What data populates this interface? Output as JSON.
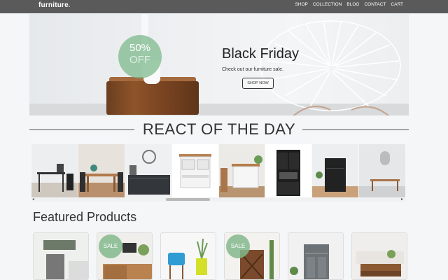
{
  "nav": {
    "logo": "furniture",
    "logo_dot": ".",
    "links": [
      "SHOP",
      "COLLECTION",
      "BLOG",
      "CONTACT",
      "CART"
    ]
  },
  "hero": {
    "badge_percent": "50%",
    "badge_off": "OFF",
    "title": "Black Friday",
    "subtitle": "Check out our furniture sale.",
    "button": "SHOP NOW"
  },
  "section": {
    "title": "REACT OF THE DAY"
  },
  "carousel": {
    "items": [
      "desk-and-chair",
      "dining-set",
      "sideboard",
      "kitchen-cart",
      "kitchen-island",
      "black-cabinet",
      "storage-cabinet",
      "console-table"
    ]
  },
  "featured": {
    "title": "Featured Products",
    "sale_label": "SALE",
    "products": [
      "living-room",
      "wood-sideboard",
      "blue-chair",
      "wine-cabinet",
      "gray-cabinet",
      "coffee-table"
    ]
  },
  "colors": {
    "nav_bg": "#5a5a5a",
    "accent_green": "#7db98c",
    "page_bg": "#f5f6f8"
  }
}
